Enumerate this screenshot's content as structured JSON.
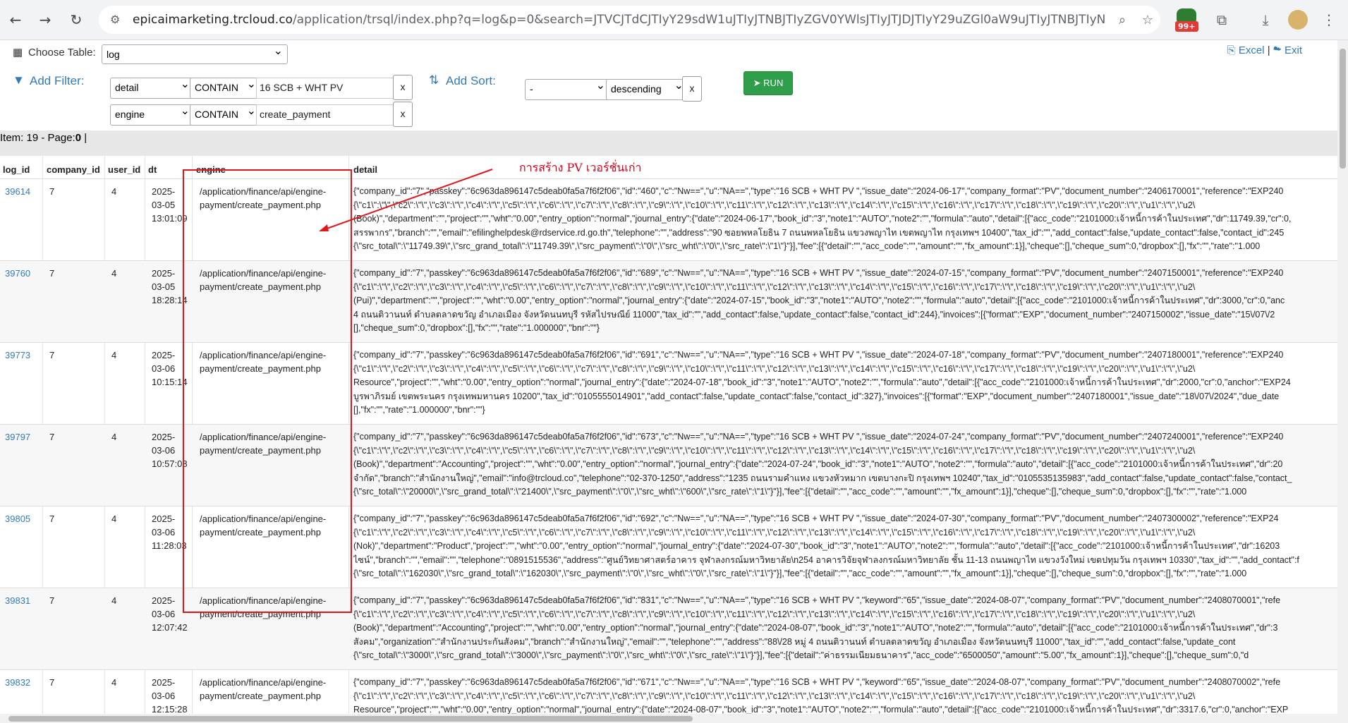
{
  "browser": {
    "url_host": "epicaimarketing.trcloud.co",
    "url_path": "/application/trsql/index.php?q=log&p=0&search=JTVCJTdCJTIyY29sdW1uJTIyJTNBJTIyZGV0YWlsJTIyJTJDJTIyY29uZGl0aW9uJTIyJTNBJTIyNy...",
    "badge": "99+"
  },
  "toolbar": {
    "choose_table_label": "Choose Table:",
    "table_value": "log",
    "excel_label": "Excel",
    "exit_label": "Exit",
    "separator": "|",
    "add_filter_label": "Add Filter:",
    "add_sort_label": "Add Sort:",
    "run_label": "RUN",
    "filters": [
      {
        "column": "detail",
        "condition": "CONTAIN",
        "value": "16 SCB + WHT PV",
        "remove": "x"
      },
      {
        "column": "engine",
        "condition": "CONTAIN",
        "value": "create_payment",
        "remove": "x"
      }
    ],
    "sort": {
      "column": "-",
      "order": "descending",
      "remove": "x"
    }
  },
  "status": {
    "text": "Item: 19 - Page:",
    "page": "0",
    "sep": "|"
  },
  "table": {
    "headers": [
      "log_id",
      "company_id",
      "user_id",
      "dt",
      "engine",
      "detail"
    ],
    "rows": [
      {
        "log_id": "39614",
        "company_id": "7",
        "user_id": "4",
        "dt1": "2025-",
        "dt2": "03-05",
        "dt3": "13:01:09",
        "engine1": "/application/finance/api/engine-",
        "engine2": "payment/create_payment.php",
        "detail": [
          "{\"company_id\":\"7\",\"passkey\":\"6c963da896147c5deab0fa5a7f6f2f06\",\"id\":\"460\",\"c\":\"Nw==\",\"u\":\"NA==\",\"type\":\"16 SCB + WHT PV \",\"issue_date\":\"2024-06-17\",\"company_format\":\"PV\",\"document_number\":\"2406170001\",\"reference\":\"EXP240",
          "{\\\"c1\\\":\\\"\\\",\\\"c2\\\":\\\"\\\",\\\"c3\\\":\\\"\\\",\\\"c4\\\":\\\"\\\",\\\"c5\\\":\\\"\\\",\\\"c6\\\":\\\"\\\",\\\"c7\\\":\\\"\\\",\\\"c8\\\":\\\"\\\",\\\"c9\\\":\\\"\\\",\\\"c10\\\":\\\"\\\",\\\"c11\\\":\\\"\\\",\\\"c12\\\":\\\"\\\",\\\"c13\\\":\\\"\\\",\\\"c14\\\":\\\"\\\",\\\"c15\\\":\\\"\\\",\\\"c16\\\":\\\"\\\",\\\"c17\\\":\\\"\\\",\\\"c18\\\":\\\"\\\",\\\"c19\\\":\\\"\\\",\\\"c20\\\":\\\"\\\",\\\"u1\\\":\\\"\\\",\\\"u2\\",
          "(Book)\",\"department\":\"\",\"project\":\"\",\"wht\":\"0.00\",\"entry_option\":\"normal\",\"journal_entry\":{\"date\":\"2024-06-17\",\"book_id\":\"3\",\"note1\":\"AUTO\",\"note2\":\"\",\"formula\":\"auto\",\"detail\":[{\"acc_code\":\"2101000:เจ้าหนี้การค้าในประเทศ\",\"dr\":11749.39,\"cr\":0,",
          "สรรพากร\",\"branch\":\"\",\"email\":\"efilinghelpdesk@rdservice.rd.go.th\",\"telephone\":\"\",\"address\":\"90 ซอยพหลโยธิน 7 ถนนพหลโยธิน แขวงพญาไท เขตพญาไท กรุงเทพฯ 10400\",\"tax_id\":\"\",\"add_contact\":false,\"update_contact\":false,\"contact_id\":245",
          "{\\\"src_total\\\":\\\"11749.39\\\",\\\"src_grand_total\\\":\\\"11749.39\\\",\\\"src_payment\\\":\\\"0\\\",\\\"src_wht\\\":\\\"0\\\",\\\"src_rate\\\":\\\"1\\\"}\"}],\"fee\":[{\"detail\":\"\",\"acc_code\":\"\",\"amount\":\"\",\"fx_amount\":1}],\"cheque\":[],\"cheque_sum\":0,\"dropbox\":[],\"fx\":\"\",\"rate\":\"1.000"
        ]
      },
      {
        "log_id": "39760",
        "company_id": "7",
        "user_id": "4",
        "dt1": "2025-",
        "dt2": "03-05",
        "dt3": "18:28:14",
        "engine1": "/application/finance/api/engine-",
        "engine2": "payment/create_payment.php",
        "detail": [
          "{\"company_id\":\"7\",\"passkey\":\"6c963da896147c5deab0fa5a7f6f2f06\",\"id\":\"689\",\"c\":\"Nw==\",\"u\":\"NA==\",\"type\":\"16 SCB + WHT PV \",\"issue_date\":\"2024-07-15\",\"company_format\":\"PV\",\"document_number\":\"2407150001\",\"reference\":\"EXP240",
          "{\\\"c1\\\":\\\"\\\",\\\"c2\\\":\\\"\\\",\\\"c3\\\":\\\"\\\",\\\"c4\\\":\\\"\\\",\\\"c5\\\":\\\"\\\",\\\"c6\\\":\\\"\\\",\\\"c7\\\":\\\"\\\",\\\"c8\\\":\\\"\\\",\\\"c9\\\":\\\"\\\",\\\"c10\\\":\\\"\\\",\\\"c11\\\":\\\"\\\",\\\"c12\\\":\\\"\\\",\\\"c13\\\":\\\"\\\",\\\"c14\\\":\\\"\\\",\\\"c15\\\":\\\"\\\",\\\"c16\\\":\\\"\\\",\\\"c17\\\":\\\"\\\",\\\"c18\\\":\\\"\\\",\\\"c19\\\":\\\"\\\",\\\"c20\\\":\\\"\\\",\\\"u1\\\":\\\"\\\",\\\"u2\\",
          "(Pui)\",\"department\":\"\",\"project\":\"\",\"wht\":\"0.00\",\"entry_option\":\"normal\",\"journal_entry\":{\"date\":\"2024-07-15\",\"book_id\":\"3\",\"note1\":\"AUTO\",\"note2\":\"\",\"formula\":\"auto\",\"detail\":[{\"acc_code\":\"2101000:เจ้าหนี้การค้าในประเทศ\",\"dr\":3000,\"cr\":0,\"anc",
          "4 ถนนติวานนท์ ตำบลตลาดขวัญ อำเภอเมือง จังหวัดนนทบุรี รหัสไปรษณีย์ 11000\",\"tax_id\":\"\",\"add_contact\":false,\"update_contact\":false,\"contact_id\":244},\"invoices\":[{\"format\":\"EXP\",\"document_number\":\"2407150002\",\"issue_date\":\"15\\/07\\/2",
          "[],\"cheque_sum\":0,\"dropbox\":[],\"fx\":\"\",\"rate\":\"1.000000\",\"bnr\":\"\"}"
        ]
      },
      {
        "log_id": "39773",
        "company_id": "7",
        "user_id": "4",
        "dt1": "2025-",
        "dt2": "03-06",
        "dt3": "10:15:14",
        "engine1": "/application/finance/api/engine-",
        "engine2": "payment/create_payment.php",
        "detail": [
          "{\"company_id\":\"7\",\"passkey\":\"6c963da896147c5deab0fa5a7f6f2f06\",\"id\":\"691\",\"c\":\"Nw==\",\"u\":\"NA==\",\"type\":\"16 SCB + WHT PV \",\"issue_date\":\"2024-07-18\",\"company_format\":\"PV\",\"document_number\":\"2407180001\",\"reference\":\"EXP240",
          "{\\\"c1\\\":\\\"\\\",\\\"c2\\\":\\\"\\\",\\\"c3\\\":\\\"\\\",\\\"c4\\\":\\\"\\\",\\\"c5\\\":\\\"\\\",\\\"c6\\\":\\\"\\\",\\\"c7\\\":\\\"\\\",\\\"c8\\\":\\\"\\\",\\\"c9\\\":\\\"\\\",\\\"c10\\\":\\\"\\\",\\\"c11\\\":\\\"\\\",\\\"c12\\\":\\\"\\\",\\\"c13\\\":\\\"\\\",\\\"c14\\\":\\\"\\\",\\\"c15\\\":\\\"\\\",\\\"c16\\\":\\\"\\\",\\\"c17\\\":\\\"\\\",\\\"c18\\\":\\\"\\\",\\\"c19\\\":\\\"\\\",\\\"c20\\\":\\\"\\\",\\\"u1\\\":\\\"\\\",\\\"u2\\",
          "Resource\",\"project\":\"\",\"wht\":\"0.00\",\"entry_option\":\"normal\",\"journal_entry\":{\"date\":\"2024-07-18\",\"book_id\":\"3\",\"note1\":\"AUTO\",\"note2\":\"\",\"formula\":\"auto\",\"detail\":[{\"acc_code\":\"2101000:เจ้าหนี้การค้าในประเทศ\",\"dr\":2000,\"cr\":0,\"anchor\":\"EXP24",
          "บูรพาภิรมย์ เขตพระนคร กรุงเทพมหานคร 10200\",\"tax_id\":\"0105555014901\",\"add_contact\":false,\"update_contact\":false,\"contact_id\":327},\"invoices\":[{\"format\":\"EXP\",\"document_number\":\"2407180001\",\"issue_date\":\"18\\/07\\/2024\",\"due_date",
          "[],\"fx\":\"\",\"rate\":\"1.000000\",\"bnr\":\"\"}"
        ]
      },
      {
        "log_id": "39797",
        "company_id": "7",
        "user_id": "4",
        "dt1": "2025-",
        "dt2": "03-06",
        "dt3": "10:57:08",
        "engine1": "/application/finance/api/engine-",
        "engine2": "payment/create_payment.php",
        "detail": [
          "{\"company_id\":\"7\",\"passkey\":\"6c963da896147c5deab0fa5a7f6f2f06\",\"id\":\"673\",\"c\":\"Nw==\",\"u\":\"NA==\",\"type\":\"16 SCB + WHT PV \",\"issue_date\":\"2024-07-24\",\"company_format\":\"PV\",\"document_number\":\"2407240001\",\"reference\":\"EXP240",
          "{\\\"c1\\\":\\\"\\\",\\\"c2\\\":\\\"\\\",\\\"c3\\\":\\\"\\\",\\\"c4\\\":\\\"\\\",\\\"c5\\\":\\\"\\\",\\\"c6\\\":\\\"\\\",\\\"c7\\\":\\\"\\\",\\\"c8\\\":\\\"\\\",\\\"c9\\\":\\\"\\\",\\\"c10\\\":\\\"\\\",\\\"c11\\\":\\\"\\\",\\\"c12\\\":\\\"\\\",\\\"c13\\\":\\\"\\\",\\\"c14\\\":\\\"\\\",\\\"c15\\\":\\\"\\\",\\\"c16\\\":\\\"\\\",\\\"c17\\\":\\\"\\\",\\\"c18\\\":\\\"\\\",\\\"c19\\\":\\\"\\\",\\\"c20\\\":\\\"\\\",\\\"u1\\\":\\\"\\\",\\\"u2\\",
          "(Book)\",\"department\":\"Accounting\",\"project\":\"\",\"wht\":\"0.00\",\"entry_option\":\"normal\",\"journal_entry\":{\"date\":\"2024-07-24\",\"book_id\":\"3\",\"note1\":\"AUTO\",\"note2\":\"\",\"formula\":\"auto\",\"detail\":[{\"acc_code\":\"2101000:เจ้าหนี้การค้าในประเทศ\",\"dr\":20",
          "จำกัด\",\"branch\":\"สำนักงานใหญ่\",\"email\":\"info@trcloud.co\",\"telephone\":\"02-370-1250\",\"address\":\"1235 ถนนรามคำแหง แขวงหัวหมาก เขตบางกะปิ กรุงเทพฯ 10240\",\"tax_id\":\"0105535135983\",\"add_contact\":false,\"update_contact\":false,\"contact_",
          "{\\\"src_total\\\":\\\"20000\\\",\\\"src_grand_total\\\":\\\"21400\\\",\\\"src_payment\\\":\\\"0\\\",\\\"src_wht\\\":\\\"600\\\",\\\"src_rate\\\":\\\"1\\\"}\"}],\"fee\":[{\"detail\":\"\",\"acc_code\":\"\",\"amount\":\"\",\"fx_amount\":1}],\"cheque\":[],\"cheque_sum\":0,\"dropbox\":[],\"fx\":\"\",\"rate\":\"1.000"
        ]
      },
      {
        "log_id": "39805",
        "company_id": "7",
        "user_id": "4",
        "dt1": "2025-",
        "dt2": "03-06",
        "dt3": "11:28:03",
        "engine1": "/application/finance/api/engine-",
        "engine2": "payment/create_payment.php",
        "detail": [
          "{\"company_id\":\"7\",\"passkey\":\"6c963da896147c5deab0fa5a7f6f2f06\",\"id\":\"692\",\"c\":\"Nw==\",\"u\":\"NA==\",\"type\":\"16 SCB + WHT PV \",\"issue_date\":\"2024-07-30\",\"company_format\":\"PV\",\"document_number\":\"2407300002\",\"reference\":\"EXP24",
          "{\\\"c1\\\":\\\"\\\",\\\"c2\\\":\\\"\\\",\\\"c3\\\":\\\"\\\",\\\"c4\\\":\\\"\\\",\\\"c5\\\":\\\"\\\",\\\"c6\\\":\\\"\\\",\\\"c7\\\":\\\"\\\",\\\"c8\\\":\\\"\\\",\\\"c9\\\":\\\"\\\",\\\"c10\\\":\\\"\\\",\\\"c11\\\":\\\"\\\",\\\"c12\\\":\\\"\\\",\\\"c13\\\":\\\"\\\",\\\"c14\\\":\\\"\\\",\\\"c15\\\":\\\"\\\",\\\"c16\\\":\\\"\\\",\\\"c17\\\":\\\"\\\",\\\"c18\\\":\\\"\\\",\\\"c19\\\":\\\"\\\",\\\"c20\\\":\\\"\\\",\\\"u1\\\":\\\"\\\",\\\"u2\\",
          "(Nok)\",\"department\":\"Product\",\"project\":\"\",\"wht\":\"0.00\",\"entry_option\":\"normal\",\"journal_entry\":{\"date\":\"2024-07-30\",\"book_id\":\"3\",\"note1\":\"AUTO\",\"note2\":\"\",\"formula\":\"auto\",\"detail\":[{\"acc_code\":\"2101000:เจ้าหนี้การค้าในประเทศ\",\"dr\":16203",
          "ไซน์\",\"branch\":\"\",\"email\":\"\",\"telephone\":\"0891515536\",\"address\":\"ศูนย์วิทยาศาสตร์อาคาร จุฬาลงกรณ์มหาวิทยาลัย\\n254 อาคารวิจัยจุฬาลงกรณ์มหาวิทยาลัย ชั้น 11-13 ถนนพญาไท แขวงวังใหม่ เขตปทุมวัน กรุงเทพฯ 10330\",\"tax_id\":\"\",\"add_contact\":f",
          "{\\\"src_total\\\":\\\"162030\\\",\\\"src_grand_total\\\":\\\"162030\\\",\\\"src_payment\\\":\\\"0\\\",\\\"src_wht\\\":\\\"0\\\",\\\"src_rate\\\":\\\"1\\\"}\"}],\"fee\":[{\"detail\":\"\",\"acc_code\":\"\",\"amount\":\"\",\"fx_amount\":1}],\"cheque\":[],\"cheque_sum\":0,\"dropbox\":[],\"fx\":\"\",\"rate\":\"1.000"
        ]
      },
      {
        "log_id": "39831",
        "company_id": "7",
        "user_id": "4",
        "dt1": "2025-",
        "dt2": "03-06",
        "dt3": "12:07:42",
        "engine1": "/application/finance/api/engine-",
        "engine2": "payment/create_payment.php",
        "detail": [
          "{\"company_id\":\"7\",\"passkey\":\"6c963da896147c5deab0fa5a7f6f2f06\",\"id\":\"831\",\"c\":\"Nw==\",\"u\":\"NA==\",\"type\":\"16 SCB + WHT PV \",\"keyword\":\"65\",\"issue_date\":\"2024-08-07\",\"company_format\":\"PV\",\"document_number\":\"2408070001\",\"refe",
          "{\\\"c1\\\":\\\"\\\",\\\"c2\\\":\\\"\\\",\\\"c3\\\":\\\"\\\",\\\"c4\\\":\\\"\\\",\\\"c5\\\":\\\"\\\",\\\"c6\\\":\\\"\\\",\\\"c7\\\":\\\"\\\",\\\"c8\\\":\\\"\\\",\\\"c9\\\":\\\"\\\",\\\"c10\\\":\\\"\\\",\\\"c11\\\":\\\"\\\",\\\"c12\\\":\\\"\\\",\\\"c13\\\":\\\"\\\",\\\"c14\\\":\\\"\\\",\\\"c15\\\":\\\"\\\",\\\"c16\\\":\\\"\\\",\\\"c17\\\":\\\"\\\",\\\"c18\\\":\\\"\\\",\\\"c19\\\":\\\"\\\",\\\"c20\\\":\\\"\\\",\\\"u1\\\":\\\"\\\",\\\"u2\\",
          "(Book)\",\"department\":\"Accounting\",\"project\":\"\",\"wht\":\"0.00\",\"entry_option\":\"normal\",\"journal_entry\":{\"date\":\"2024-08-07\",\"book_id\":\"3\",\"note1\":\"AUTO\",\"note2\":\"\",\"formula\":\"auto\",\"detail\":[{\"acc_code\":\"2101000:เจ้าหนี้การค้าในประเทศ\",\"dr\":3",
          "สังคม\",\"organization\":\"สำนักงานประกันสังคม\",\"branch\":\"สำนักงานใหญ่\",\"email\":\"\",\"telephone\":\"\",\"address\":\"88\\/28 หมู่ 4 ถนนติวานนท์ ตำบลตลาดขวัญ อำเภอเมือง จังหวัดนนทบุรี 11000\",\"tax_id\":\"\",\"add_contact\":false,\"update_cont",
          "{\\\"src_total\\\":\\\"3000\\\",\\\"src_grand_total\\\":\\\"3000\\\",\\\"src_payment\\\":\\\"0\\\",\\\"src_wht\\\":\\\"0\\\",\\\"src_rate\\\":\\\"1\\\"}\"}],\"fee\":[{\"detail\":\"ค่าธรรมเนียมธนาคาร\",\"acc_code\":\"6500050\",\"amount\":\"5.00\",\"fx_amount\":1}],\"cheque\":[],\"cheque_sum\":0,\"d"
        ]
      },
      {
        "log_id": "39832",
        "company_id": "7",
        "user_id": "4",
        "dt1": "2025-",
        "dt2": "03-06",
        "dt3": "12:15:28",
        "engine1": "/application/finance/api/engine-",
        "engine2": "payment/create_payment.php",
        "detail": [
          "{\"company_id\":\"7\",\"passkey\":\"6c963da896147c5deab0fa5a7f6f2f06\",\"id\":\"671\",\"c\":\"Nw==\",\"u\":\"NA==\",\"type\":\"16 SCB + WHT PV \",\"keyword\":\"65\",\"issue_date\":\"2024-08-07\",\"company_format\":\"PV\",\"document_number\":\"2408070002\",\"refe",
          "{\\\"c1\\\":\\\"\\\",\\\"c2\\\":\\\"\\\",\\\"c3\\\":\\\"\\\",\\\"c4\\\":\\\"\\\",\\\"c5\\\":\\\"\\\",\\\"c6\\\":\\\"\\\",\\\"c7\\\":\\\"\\\",\\\"c8\\\":\\\"\\\",\\\"c9\\\":\\\"\\\",\\\"c10\\\":\\\"\\\",\\\"c11\\\":\\\"\\\",\\\"c12\\\":\\\"\\\",\\\"c13\\\":\\\"\\\",\\\"c14\\\":\\\"\\\",\\\"c15\\\":\\\"\\\",\\\"c16\\\":\\\"\\\",\\\"c17\\\":\\\"\\\",\\\"c18\\\":\\\"\\\",\\\"c19\\\":\\\"\\\",\\\"c20\\\":\\\"\\\",\\\"u1\\\":\\\"\\\",\\\"u2\\",
          "Resource\",\"project\":\"\",\"wht\":\"0.00\",\"entry_option\":\"normal\",\"journal_entry\":{\"date\":\"2024-08-07\",\"book_id\":\"3\",\"note1\":\"AUTO\",\"note2\":\"\",\"formula\":\"auto\",\"detail\":[{\"acc_code\":\"2101000:เจ้าหนี้การค้าในประเทศ\",\"dr\":3317.6,\"cr\":0,\"anchor\":\"EXP"
        ]
      }
    ]
  },
  "annotation": {
    "text": "การสร้าง PV เวอร์ชั่นเก่า",
    "color": "#d0021b"
  }
}
